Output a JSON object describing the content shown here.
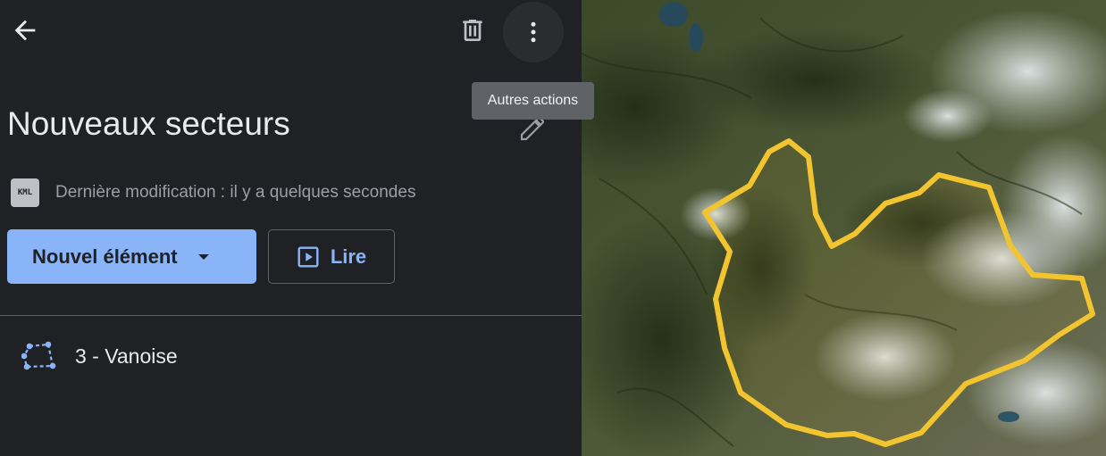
{
  "header": {
    "back_icon": "arrow-back-icon",
    "delete_icon": "trash-icon",
    "more_icon": "more-vertical-icon"
  },
  "tooltip": {
    "text": "Autres actions"
  },
  "project": {
    "title": "Nouveaux secteurs",
    "edit_icon": "pencil-icon",
    "badge_text": "KML",
    "last_modified": "Dernière modification : il y a quelques secondes"
  },
  "actions": {
    "new_element_label": "Nouvel élément",
    "play_label": "Lire"
  },
  "features": [
    {
      "label": "3 - Vanoise",
      "icon": "polygon-icon"
    }
  ],
  "colors": {
    "panel_bg": "#202124",
    "accent": "#8ab4f8",
    "polygon_outline": "#f2c530"
  }
}
